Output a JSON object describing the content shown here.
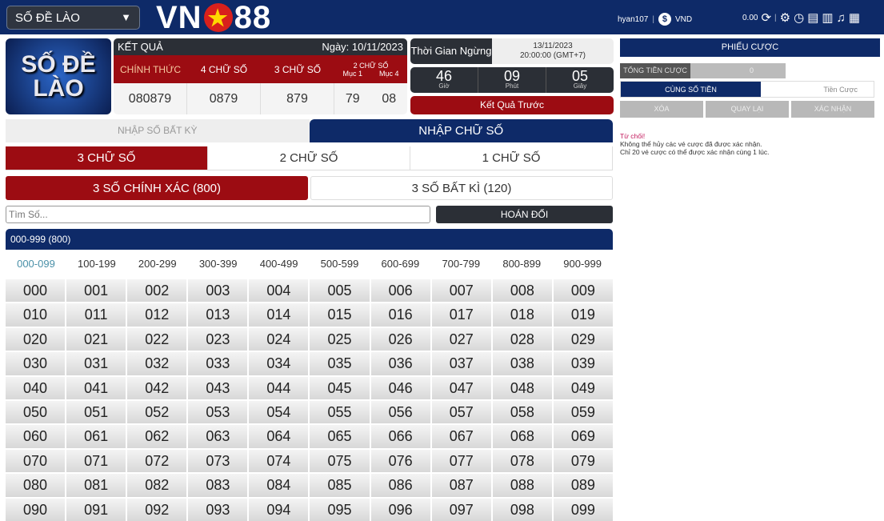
{
  "header": {
    "game_select": "SỐ ĐỀ LÀO",
    "logo_left": "VN",
    "logo_right": "88",
    "username": "hyan107",
    "currency": "VND",
    "balance": "0.00",
    "icons": [
      "refresh-icon",
      "settings-icon",
      "history-icon",
      "document-icon",
      "clipboard-icon",
      "sound-icon",
      "book-icon"
    ]
  },
  "banner": {
    "text": "SỐ ĐỀ LÀO"
  },
  "result": {
    "title": "KẾT QUẢ",
    "date": "Ngày: 10/11/2023",
    "headers": [
      "CHÍNH THỨC",
      "4 CHỮ SỐ",
      "3 CHỮ SỐ",
      "2 CHỮ SỐ"
    ],
    "sub_headers": [
      "Mục 1",
      "Mục 4"
    ],
    "values": [
      "080879",
      "0879",
      "879",
      "79",
      "08"
    ]
  },
  "stop": {
    "label": "Thời Gian Ngừng",
    "date": "13/11/2023",
    "time": "20:00:00 (GMT+7)"
  },
  "countdown": [
    {
      "value": "46",
      "unit": "Giờ"
    },
    {
      "value": "09",
      "unit": "Phút"
    },
    {
      "value": "05",
      "unit": "Giây"
    }
  ],
  "previous_result": "Kết Quả Trước",
  "mode_tabs": [
    "NHẬP SỐ BẤT KỲ",
    "NHẬP CHỮ SỐ"
  ],
  "digit_tabs": [
    "3 CHỮ SỐ",
    "2 CHỮ SỐ",
    "1 CHỮ SỐ"
  ],
  "type_tabs": [
    "3 SỐ CHÍNH XÁC (800)",
    "3 SỐ BẤT KÌ (120)"
  ],
  "search": {
    "placeholder": "Tìm Số..."
  },
  "swap_label": "HOÁN ĐỔI",
  "range_title": "000-999 (800)",
  "ranges": [
    "000-099",
    "100-199",
    "200-299",
    "300-399",
    "400-499",
    "500-599",
    "600-699",
    "700-799",
    "800-899",
    "900-999"
  ],
  "numbers": [
    "000",
    "001",
    "002",
    "003",
    "004",
    "005",
    "006",
    "007",
    "008",
    "009",
    "010",
    "011",
    "012",
    "013",
    "014",
    "015",
    "016",
    "017",
    "018",
    "019",
    "020",
    "021",
    "022",
    "023",
    "024",
    "025",
    "026",
    "027",
    "028",
    "029",
    "030",
    "031",
    "032",
    "033",
    "034",
    "035",
    "036",
    "037",
    "038",
    "039",
    "040",
    "041",
    "042",
    "043",
    "044",
    "045",
    "046",
    "047",
    "048",
    "049",
    "050",
    "051",
    "052",
    "053",
    "054",
    "055",
    "056",
    "057",
    "058",
    "059",
    "060",
    "061",
    "062",
    "063",
    "064",
    "065",
    "066",
    "067",
    "068",
    "069",
    "070",
    "071",
    "072",
    "073",
    "074",
    "075",
    "076",
    "077",
    "078",
    "079",
    "080",
    "081",
    "082",
    "083",
    "084",
    "085",
    "086",
    "087",
    "088",
    "089",
    "090",
    "091",
    "092",
    "093",
    "094",
    "095",
    "096",
    "097",
    "098",
    "099"
  ],
  "slip": {
    "title": "PHIẾU CƯỢC",
    "total_label": "TỔNG TIỀN CƯỢC",
    "total_value": "0",
    "same_amount": "CÙNG SỐ TIỀN",
    "bet_amount": "Tiền Cược",
    "clear": "XÓA",
    "back": "QUAY LẠI",
    "confirm": "XÁC NHẬN",
    "notice_title": "Từ chối!",
    "notice_1": "Không thể hủy các vé cược đã được xác nhận.",
    "notice_2": "Chỉ 20 vé cược có thể được xác nhận cùng 1 lúc."
  },
  "colors": {
    "navy": "#0e2a68",
    "red": "#9c0c12",
    "dark": "#2b2f36"
  }
}
